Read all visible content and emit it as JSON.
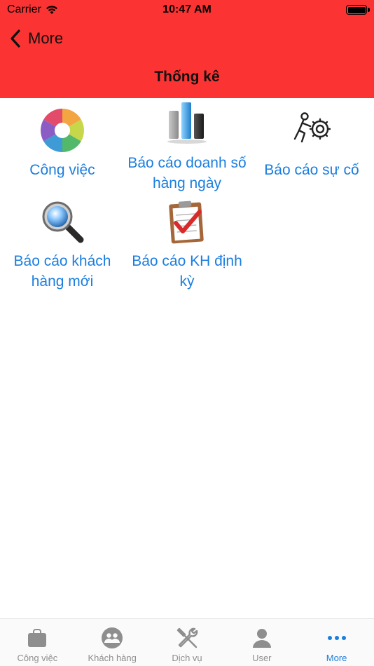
{
  "status_bar": {
    "carrier": "Carrier",
    "time": "10:47 AM"
  },
  "nav": {
    "back_label": "More",
    "title": "Thống kê"
  },
  "items": [
    {
      "label": "Công việc",
      "icon": "color-wheel-icon"
    },
    {
      "label": "Báo cáo doanh số hàng ngày",
      "icon": "bar-chart-icon"
    },
    {
      "label": "Báo cáo sự cố",
      "icon": "person-gear-icon"
    },
    {
      "label": "Báo cáo khách hàng mới",
      "icon": "magnifier-icon"
    },
    {
      "label": "Báo cáo KH định kỳ",
      "icon": "clipboard-check-icon"
    }
  ],
  "tabs": [
    {
      "label": "Công việc",
      "icon": "bag-icon",
      "active": false
    },
    {
      "label": "Khách hàng",
      "icon": "people-icon",
      "active": false
    },
    {
      "label": "Dịch vụ",
      "icon": "tools-icon",
      "active": false
    },
    {
      "label": "User",
      "icon": "user-icon",
      "active": false
    },
    {
      "label": "More",
      "icon": "more-dots-icon",
      "active": true
    }
  ],
  "colors": {
    "header": "#fc3333",
    "link": "#1a7ee0",
    "tab_inactive": "#8e8e8e"
  }
}
